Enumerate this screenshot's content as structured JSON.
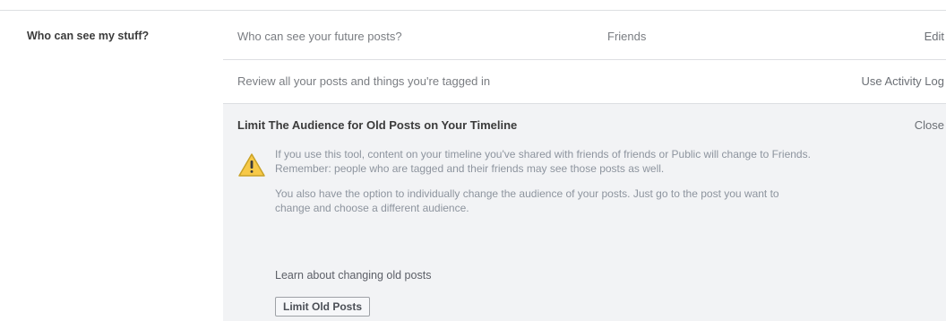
{
  "section": {
    "title": "Who can see my stuff?"
  },
  "rows": [
    {
      "question": "Who can see your future posts?",
      "value": "Friends",
      "action": "Edit"
    },
    {
      "question": "Review all your posts and things you're tagged in",
      "value": "",
      "action": "Use Activity Log"
    }
  ],
  "panel": {
    "title": "Limit The Audience for Old Posts on Your Timeline",
    "close_label": "Close",
    "icon": "warning-icon",
    "icon_color": "#f7c948",
    "paragraphs": [
      "If you use this tool, content on your timeline you've shared with friends of friends or Public will change to Friends. Remember: people who are tagged and their friends may see those posts as well.",
      "You also have the option to individually change the audience of your posts. Just go to the post you want to change and choose a different audience."
    ],
    "learn_link": "Learn about changing old posts",
    "button_label": "Limit Old Posts"
  }
}
